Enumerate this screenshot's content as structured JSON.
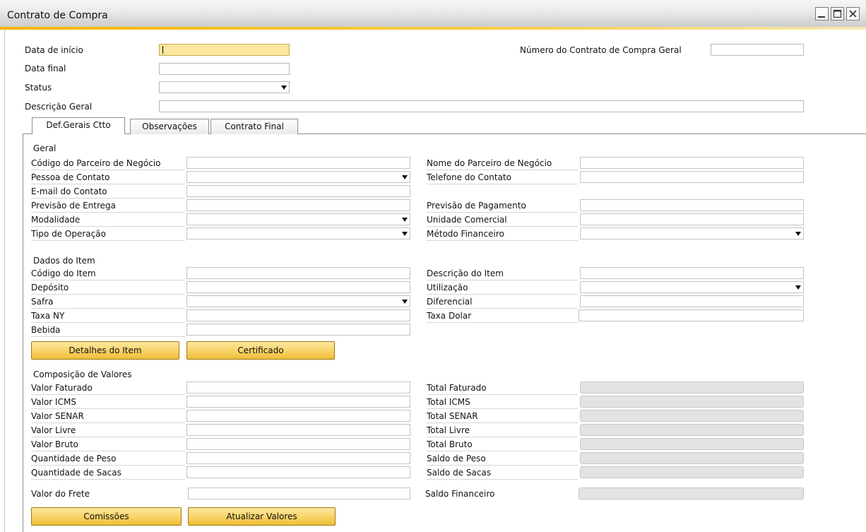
{
  "window": {
    "title": "Contrato de Compra"
  },
  "header": {
    "data_inicio_label": "Data de início",
    "data_final_label": "Data final",
    "status_label": "Status",
    "descricao_geral_label": "Descrição Geral",
    "numero_contrato_label": "Número do Contrato de Compra Geral"
  },
  "tabs": [
    {
      "label": "Def.Gerais Ctto"
    },
    {
      "label": "Observações"
    },
    {
      "label": "Contrato Final"
    }
  ],
  "geral": {
    "title": "Geral",
    "codigo_parceiro": "Código do Parceiro de Negócio",
    "pessoa_contato": "Pessoa de Contato",
    "email_contato": "E-mail do Contato",
    "previsao_entrega": "Previsão de Entrega",
    "modalidade": "Modalidade",
    "tipo_operacao": "Tipo de Operação",
    "nome_parceiro": "Nome do Parceiro de Negócio",
    "telefone_contato": "Telefone do Contato",
    "previsao_pagamento": "Previsão de Pagamento",
    "unidade_comercial": "Unidade Comercial",
    "metodo_financeiro": "Método Financeiro"
  },
  "item": {
    "title": "Dados do Item",
    "codigo_item": "Código do Item",
    "deposito": "Depósito",
    "safra": "Safra",
    "taxa_ny": "Taxa NY",
    "bebida": "Bebida",
    "descricao_item": "Descrição do Item",
    "utilizacao": "Utilização",
    "diferencial": "Diferencial",
    "taxa_dolar": "Taxa Dolar",
    "detalhes_button": "Detalhes do Item",
    "certificado_button": "Certificado"
  },
  "valores": {
    "title": "Composição de Valores",
    "valor_faturado": "Valor Faturado",
    "valor_icms": "Valor ICMS",
    "valor_senar": "Valor SENAR",
    "valor_livre": "Valor Livre",
    "valor_bruto": "Valor Bruto",
    "quantidade_peso": "Quantidade de Peso",
    "quantidade_sacas": "Quantidade de Sacas",
    "valor_frete": "Valor do Frete",
    "total_faturado": "Total Faturado",
    "total_icms": "Total ICMS",
    "total_senar": "Total SENAR",
    "total_livre": "Total Livre",
    "total_bruto": "Total Bruto",
    "saldo_peso": "Saldo de Peso",
    "saldo_sacas": "Saldo de Sacas",
    "saldo_financeiro": "Saldo Financeiro",
    "comissoes_button": "Comissões",
    "atualizar_button": "Atualizar Valores"
  },
  "colors": {
    "accent": "#f8cf4a",
    "active_field": "#fbe7a0",
    "readonly_field": "#e3e3e3"
  },
  "icons": [
    "minimize-icon",
    "maximize-icon",
    "close-icon",
    "dropdown-arrow-icon"
  ]
}
